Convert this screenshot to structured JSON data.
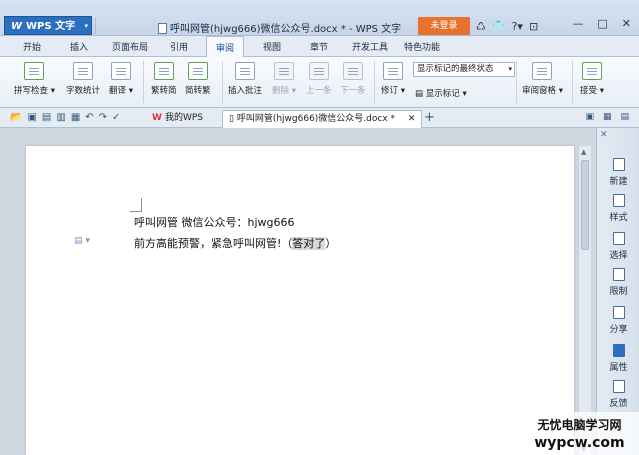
{
  "app": {
    "name": "WPS 文字",
    "logo": "W",
    "document_title": "呼叫网管(hjwg666)微信公众号.docx * - WPS 文字",
    "login_button": "未登录"
  },
  "title_icons": {
    "skin": "♺",
    "shirt": "👕",
    "help": "?",
    "help_arrow": "▾",
    "collapse": "⊡"
  },
  "window_controls": {
    "minimize": "—",
    "restore": "□",
    "close": "✕"
  },
  "tabs": [
    "开始",
    "插入",
    "页面布局",
    "引用",
    "审阅",
    "视图",
    "章节",
    "开发工具",
    "特色功能"
  ],
  "active_tab": "审阅",
  "ribbon": {
    "spell_check": "拼写检查",
    "spell_icon_text": "ABC",
    "word_count": "字数统计",
    "word_count_icon_text": "123\nABC",
    "translate": "翻译",
    "trad_to_simp": "繁转简",
    "simp_to_trad": "简转繁",
    "insert_comment": "插入批注",
    "delete": "删除",
    "previous": "上一条",
    "next": "下一条",
    "track_changes": "修订",
    "display_mode": "显示标记的最终状态",
    "show_markup": "显示标记",
    "review_pane": "审阅窗格",
    "accept": "接受"
  },
  "doc_tabs": {
    "my_wps": "我的WPS",
    "current_doc": "呼叫网管(hjwg666)微信公众号.docx *",
    "close": "✕",
    "new_tab": "+"
  },
  "document": {
    "line1": "呼叫网管 微信公众号：hjwg666",
    "line2_before": "前方高能预警，紧急呼叫网管!（",
    "line2_selected": "答对了",
    "line2_after": "）"
  },
  "right_panel": [
    "新建",
    "样式",
    "选择",
    "限制",
    "分享",
    "属性",
    "反馈"
  ],
  "watermark": {
    "line1": "无忧电脑学习网",
    "line2": "wypcw.com"
  },
  "colors": {
    "accent": "#2d6fbf",
    "login": "#e9712f",
    "highlight": "#d8d8d8"
  }
}
